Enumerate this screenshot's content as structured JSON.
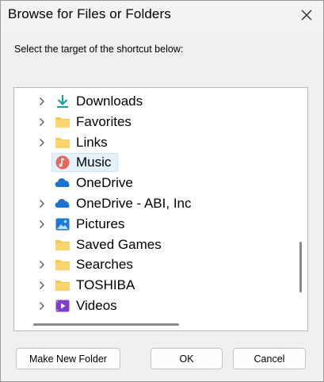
{
  "window": {
    "title": "Browse for Files or Folders"
  },
  "prompt": "Select the target of the shortcut below:",
  "tree": {
    "selected_index": 3,
    "items": [
      {
        "label": "Downloads",
        "icon": "download-icon",
        "expandable": true
      },
      {
        "label": "Favorites",
        "icon": "folder-icon",
        "expandable": true
      },
      {
        "label": "Links",
        "icon": "folder-icon",
        "expandable": true
      },
      {
        "label": "Music",
        "icon": "music-icon",
        "expandable": false
      },
      {
        "label": "OneDrive",
        "icon": "onedrive-icon",
        "expandable": false
      },
      {
        "label": "OneDrive - ABI, Inc",
        "icon": "onedrive-icon",
        "expandable": true
      },
      {
        "label": "Pictures",
        "icon": "pictures-icon",
        "expandable": true
      },
      {
        "label": "Saved Games",
        "icon": "folder-icon",
        "expandable": false
      },
      {
        "label": "Searches",
        "icon": "folder-icon",
        "expandable": true
      },
      {
        "label": "TOSHIBA",
        "icon": "folder-icon",
        "expandable": true
      },
      {
        "label": "Videos",
        "icon": "videos-icon",
        "expandable": true
      }
    ]
  },
  "buttons": {
    "new_folder": "Make New Folder",
    "ok": "OK",
    "cancel": "Cancel"
  },
  "colors": {
    "folder": "#f8c752",
    "onedrive": "#1e73d0",
    "download": "#1aa39a",
    "music": "#e8685a",
    "pictures": "#1b7ad6",
    "videos": "#7b3fc9",
    "selection": "#e5f1fb"
  }
}
